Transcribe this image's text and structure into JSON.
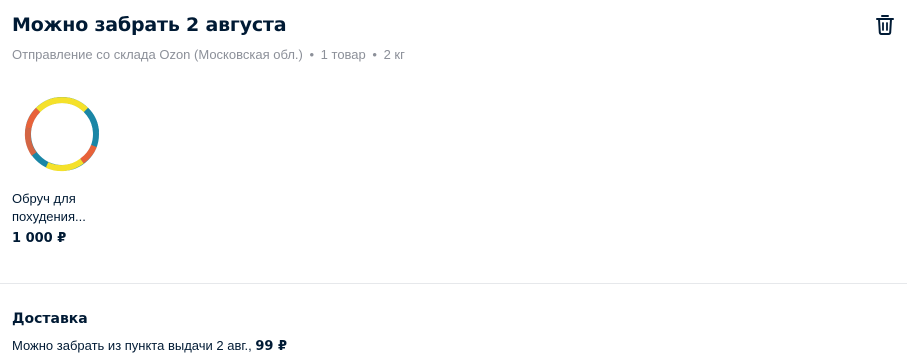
{
  "header": {
    "title": "Можно забрать 2 августа",
    "warehouse": "Отправление со склада Ozon (Московская обл.)",
    "separator": "•",
    "items_count": "1 товар",
    "weight": "2 кг",
    "delete_icon": "trash-icon"
  },
  "product": {
    "name": "Обруч для похудения...",
    "price": "1 000 ₽",
    "image_icon": "hoop-ring-image",
    "colors": {
      "blue": "#1a86a6",
      "yellow": "#f5e12a",
      "orange": "#e8623a"
    }
  },
  "delivery": {
    "title": "Доставка",
    "text": "Можно забрать из пункта выдачи 2 авг., ",
    "price": "99 ₽"
  },
  "colors": {
    "text_primary": "#001a34",
    "text_secondary": "#8c9099",
    "divider": "#e6e8eb"
  }
}
